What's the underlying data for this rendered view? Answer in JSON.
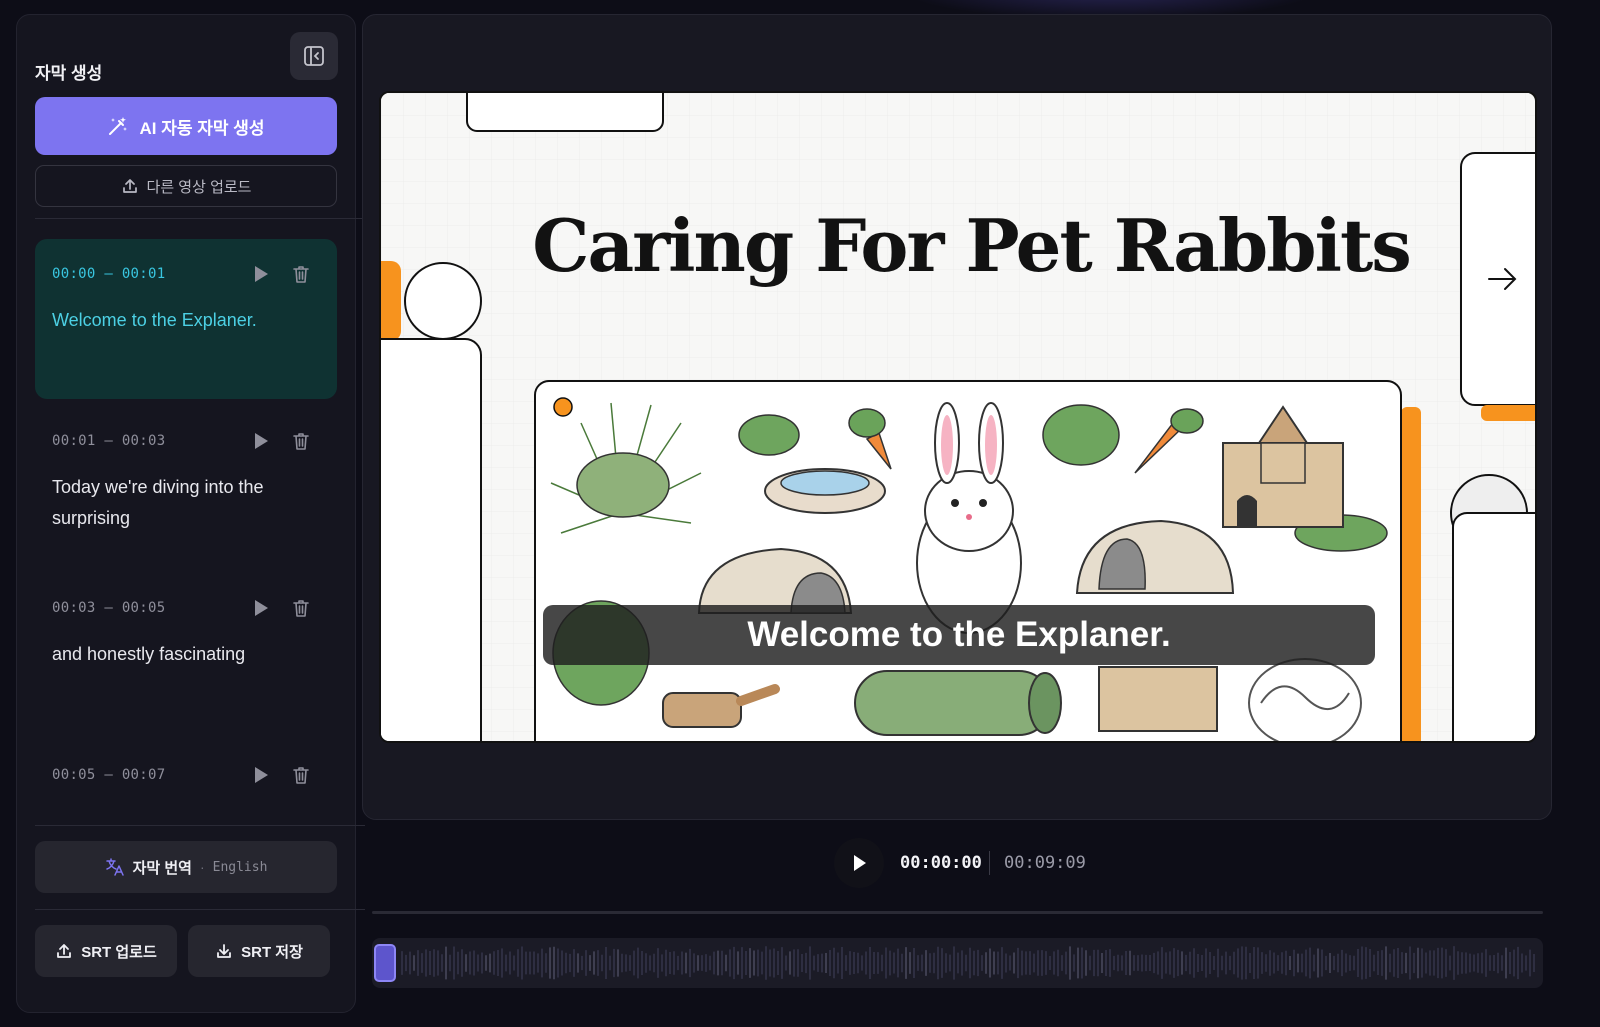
{
  "sidebar": {
    "title": "자막 생성",
    "ai_button_label": "AI 자동 자막 생성",
    "upload_button_label": "다른 영상 업로드",
    "subtitles": [
      {
        "time": "00:00 – 00:01",
        "text": "Welcome to the Explaner.",
        "active": true
      },
      {
        "time": "00:01 – 00:03",
        "text": "Today we're diving into the surprising",
        "active": false
      },
      {
        "time": "00:03 – 00:05",
        "text": "and honestly fascinating",
        "active": false
      },
      {
        "time": "00:05 – 00:07",
        "text": "",
        "active": false
      }
    ],
    "translate": {
      "label": "자막 번역",
      "separator": "·",
      "language": "English"
    },
    "srt_upload_label": "SRT 업로드",
    "srt_save_label": "SRT 저장"
  },
  "video": {
    "title": "Caring For Pet Rabbits",
    "caption": "Welcome to the Explaner."
  },
  "player": {
    "current_time": "00:00:00",
    "duration": "00:09:09",
    "progress": 0
  },
  "colors": {
    "accent": "#7d74f0",
    "active_item_bg": "#0f3232",
    "active_text": "#4cd0e4",
    "orange": "#f7931e"
  }
}
